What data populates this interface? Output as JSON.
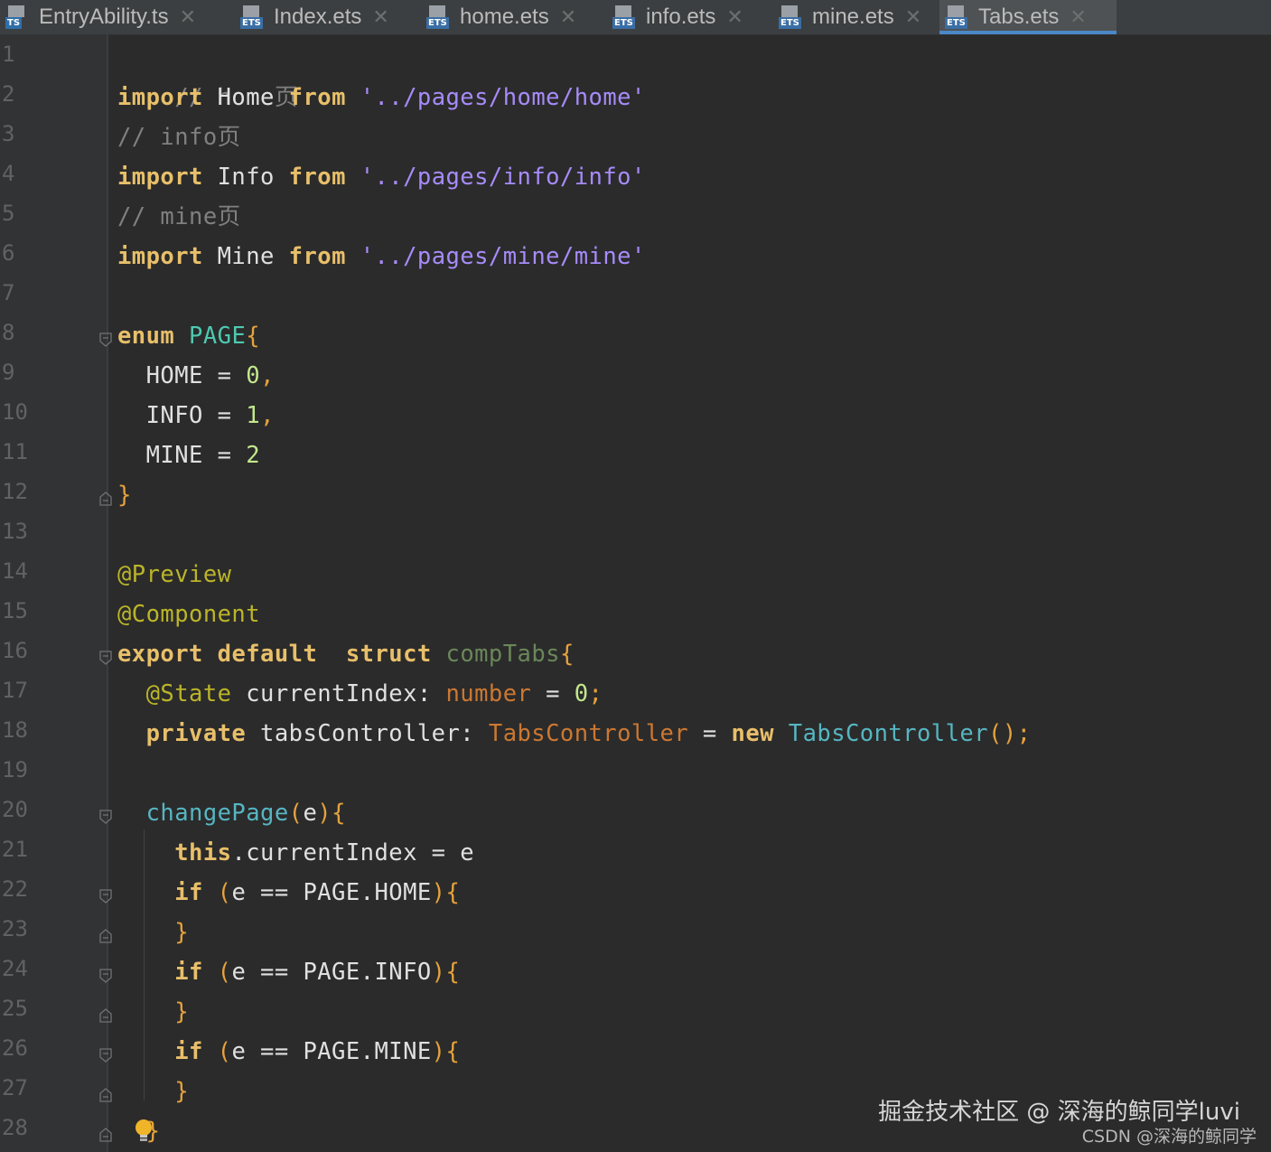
{
  "tabs": [
    {
      "name": "EntryAbility.ts",
      "type": "TS",
      "active": false
    },
    {
      "name": "Index.ets",
      "type": "ETS",
      "active": false
    },
    {
      "name": "home.ets",
      "type": "ETS",
      "active": false
    },
    {
      "name": "info.ets",
      "type": "ETS",
      "active": false
    },
    {
      "name": "mine.ets",
      "type": "ETS",
      "active": false
    },
    {
      "name": "Tabs.ets",
      "type": "ETS",
      "active": true
    }
  ],
  "close_glyph": "✕",
  "code": {
    "l1": "// home页",
    "l2_kw": "import",
    "l2_id": " Home ",
    "l2_from": "from",
    "l2_str": "'../pages/home/home'",
    "l3": "// info页",
    "l4_kw": "import",
    "l4_id": " Info ",
    "l4_from": "from",
    "l4_str": "'../pages/info/info'",
    "l5": "// mine页",
    "l6_kw": "import",
    "l6_id": " Mine ",
    "l6_from": "from",
    "l6_str": "'../pages/mine/mine'",
    "l8_kw": "enum",
    "l8_name": "PAGE",
    "l8_br": "{",
    "l9_id": "HOME",
    "l9_eq": " = ",
    "l9_num": "0",
    "l9_pn": ",",
    "l10_id": "INFO",
    "l10_eq": " = ",
    "l10_num": "1",
    "l10_pn": ",",
    "l11_id": "MINE",
    "l11_eq": " = ",
    "l11_num": "2",
    "l12_br": "}",
    "l14_dec": "@Preview",
    "l15_dec": "@Component",
    "l16_kw1": "export",
    "l16_kw2": "default",
    "l16_kw3": "struct",
    "l16_name": "compTabs",
    "l16_br": "{",
    "l17_dec": "@State",
    "l17_id": " currentIndex",
    "l17_colon": ": ",
    "l17_type": "number",
    "l17_eq": " = ",
    "l17_num": "0",
    "l17_semi": ";",
    "l18_kw": "private",
    "l18_id": " tabsController",
    "l18_colon": ": ",
    "l18_type": "TabsController",
    "l18_eq": " = ",
    "l18_new": "new",
    "l18_cls": "TabsController",
    "l18_paren": "()",
    "l18_semi": ";",
    "l20_fn": "changePage",
    "l20_p1": "(",
    "l20_arg": "e",
    "l20_p2": ")",
    "l20_br": "{",
    "l21_this": "this",
    "l21_rest": ".currentIndex = e",
    "l22_kw": "if",
    "l22_p1": " (",
    "l22_body": "e == PAGE.HOME",
    "l22_p2": ")",
    "l22_br": "{",
    "l23_br": "}",
    "l24_kw": "if",
    "l24_p1": " (",
    "l24_body": "e == PAGE.INFO",
    "l24_p2": ")",
    "l24_br": "{",
    "l25_br": "}",
    "l26_kw": "if",
    "l26_p1": " (",
    "l26_body": "e == PAGE.MINE",
    "l26_p2": ")",
    "l26_br": "{",
    "l27_br": "}",
    "l28_br": "}"
  },
  "line_numbers": [
    "1",
    "2",
    "3",
    "4",
    "5",
    "6",
    "7",
    "8",
    "9",
    "10",
    "11",
    "12",
    "13",
    "14",
    "15",
    "16",
    "17",
    "18",
    "19",
    "20",
    "21",
    "22",
    "23",
    "24",
    "25",
    "26",
    "27",
    "28"
  ],
  "watermark": {
    "primary": "掘金技术社区 @ 深海的鲸同学luvi",
    "secondary": "CSDN @深海的鲸同学"
  },
  "colors": {
    "background": "#2b2b2b",
    "gutter": "#313335",
    "keyword": "#e8bf6a",
    "string": "#a78bfa",
    "comment": "#808080",
    "accent": "#4a88c7"
  }
}
